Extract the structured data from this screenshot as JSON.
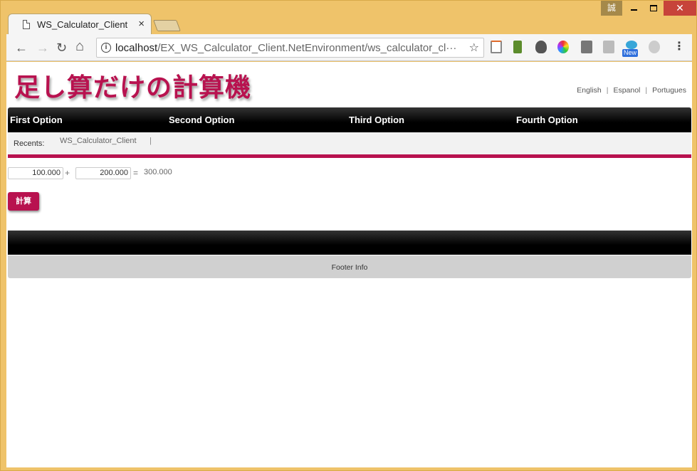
{
  "window": {
    "ime_indicator": "誠",
    "close_glyph": "✕"
  },
  "tab": {
    "title": "WS_Calculator_Client",
    "close_glyph": "×"
  },
  "toolbar": {
    "back_glyph": "←",
    "forward_glyph": "→",
    "reload_glyph": "↻",
    "home_glyph": "⌂",
    "info_glyph": "i",
    "url_host": "localhost",
    "url_path": "/EX_WS_Calculator_Client.NetEnvironment/ws_calculator_cl···",
    "star_glyph": "☆",
    "new_badge": "New",
    "menu_glyph": "⋮"
  },
  "page": {
    "site_title": "足し算だけの計算機",
    "languages": [
      "English",
      "Espanol",
      "Portugues"
    ],
    "nav": [
      "First Option",
      "Second Option",
      "Third Option",
      "Fourth Option"
    ],
    "recents_label": "Recents:",
    "recents_link": "WS_Calculator_Client",
    "recents_sep": "|",
    "operand1": "100.000",
    "plus": "+",
    "operand2": "200.000",
    "equals": "=",
    "result": "300.000",
    "calc_button": "計算",
    "footer": "Footer Info"
  },
  "colors": {
    "accent": "#b8124f",
    "window_frame": "#efc36a"
  }
}
